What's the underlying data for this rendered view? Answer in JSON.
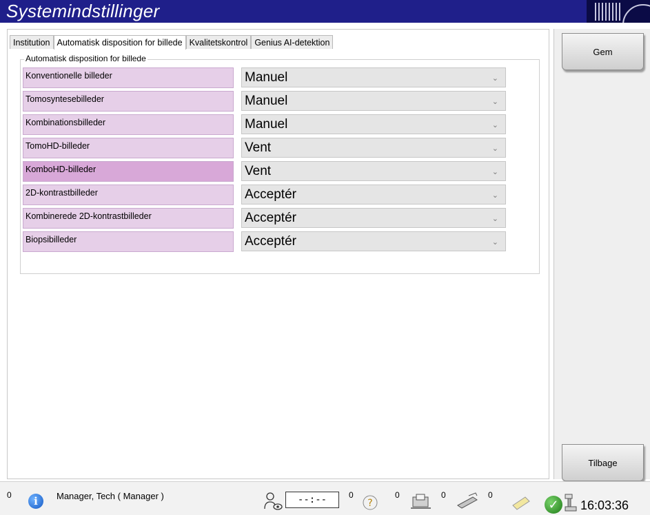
{
  "window": {
    "title": "Systemindstillinger"
  },
  "tabs": [
    {
      "label": "Institution",
      "active": false
    },
    {
      "label": "Automatisk disposition for billede",
      "active": true
    },
    {
      "label": "Kvalitetskontrol",
      "active": false
    },
    {
      "label": "Genius AI-detektion",
      "active": false
    }
  ],
  "group": {
    "title": "Automatisk disposition for billede"
  },
  "rows": [
    {
      "label": "Konventionelle billeder",
      "value": "Manuel"
    },
    {
      "label": "Tomosyntesebilleder",
      "value": "Manuel"
    },
    {
      "label": "Kombinationsbilleder",
      "value": "Manuel"
    },
    {
      "label": "TomoHD-billeder",
      "value": "Vent"
    },
    {
      "label": "KomboHD-billeder",
      "value": "Vent"
    },
    {
      "label": "2D-kontrastbilleder",
      "value": "Acceptér"
    },
    {
      "label": "Kombinerede 2D-kontrastbilleder",
      "value": "Acceptér"
    },
    {
      "label": "Biopsibilleder",
      "value": "Acceptér"
    }
  ],
  "side": {
    "save_label": "Gem",
    "back_label": "Tilbage"
  },
  "statusbar": {
    "notification_count": "0",
    "user": "Manager, Tech ( Manager )",
    "timer": "--:--",
    "count_timer": "0",
    "count_help": "0",
    "count_output": "0",
    "count_print": "0",
    "clock": "16:03:36"
  },
  "colors": {
    "titlebar": "#1f1f8a",
    "label_bg": "#e6cfe8",
    "label_highlight": "#d8a8d8",
    "select_bg": "#e5e5e5"
  },
  "icons": [
    "info-icon",
    "patient-icon",
    "timer-icon",
    "help-icon",
    "output-icon",
    "print-icon",
    "note-icon",
    "check-icon",
    "device-icon"
  ]
}
